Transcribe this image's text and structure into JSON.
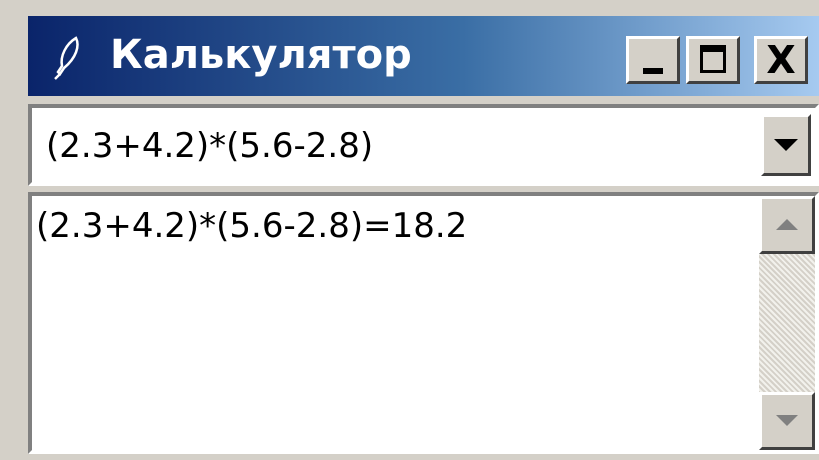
{
  "window": {
    "title": "Калькулятор",
    "icon": "feather-icon",
    "controls": {
      "minimize_icon": "minimize-icon",
      "maximize_icon": "maximize-icon",
      "close_label": "X"
    }
  },
  "input": {
    "value": "(2.3+4.2)*(5.6-2.8)",
    "dropdown_icon": "chevron-down-icon"
  },
  "output": {
    "lines": [
      "(2.3+4.2)*(5.6-2.8)=18.2"
    ],
    "scroll_up_icon": "scroll-up-icon",
    "scroll_down_icon": "scroll-down-icon"
  },
  "colors": {
    "titlebar_start": "#0a246a",
    "titlebar_end": "#a6caf0",
    "face": "#d4d0c8"
  }
}
